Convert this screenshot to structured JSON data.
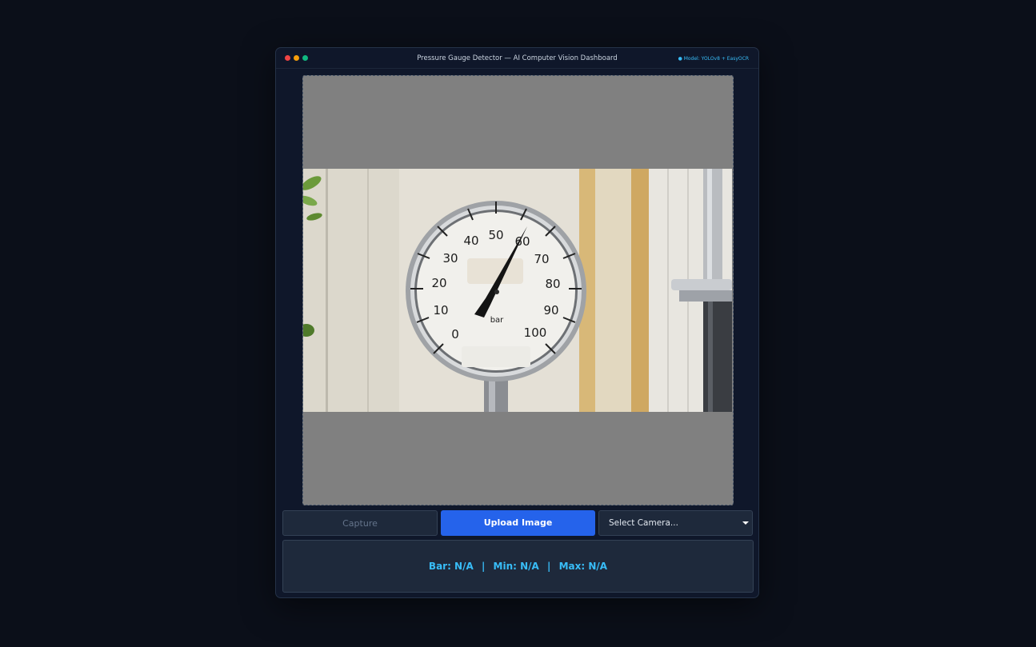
{
  "window": {
    "title": "Pressure Gauge Detector — AI Computer Vision Dashboard",
    "model_info": "● Model: YOLOv8 + EasyOCR"
  },
  "gauge": {
    "dial_labels": [
      "0",
      "10",
      "20",
      "30",
      "40",
      "50",
      "60",
      "70",
      "80",
      "90",
      "100"
    ],
    "unit": "bar"
  },
  "controls": {
    "capture_label": "Capture",
    "upload_label": "Upload Image",
    "camera_select_value": "Select Camera..."
  },
  "readout": {
    "bar": "Bar: N/A",
    "min": "Min: N/A",
    "max": "Max: N/A",
    "separator": "|"
  },
  "colors": {
    "accent": "#2563eb",
    "readout_text": "#38bdf8",
    "background": "#0b0f19"
  }
}
